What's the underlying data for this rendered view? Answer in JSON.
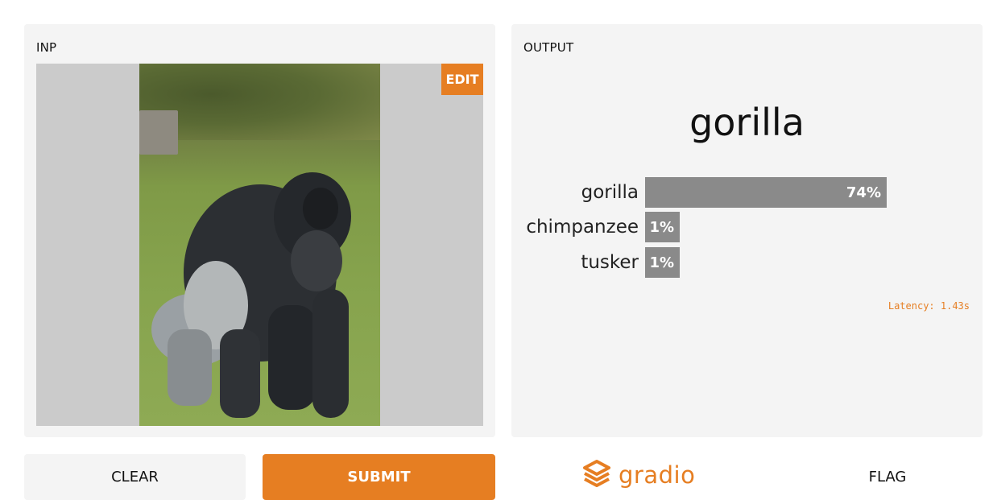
{
  "input_panel": {
    "title": "INP",
    "edit_label": "EDIT"
  },
  "output_panel": {
    "title": "OUTPUT",
    "label": "gorilla",
    "confidences": [
      {
        "name": "gorilla",
        "value": 0.74,
        "text": "74%"
      },
      {
        "name": "chimpanzee",
        "value": 0.01,
        "text": "1%"
      },
      {
        "name": "tusker",
        "value": 0.01,
        "text": "1%"
      }
    ],
    "latency": "Latency: 1.43s"
  },
  "buttons": {
    "clear": "CLEAR",
    "submit": "SUBMIT",
    "flag": "FLAG"
  },
  "brand": {
    "name": "gradio",
    "icon": "gradio-logo-icon"
  },
  "colors": {
    "accent": "#e67e22",
    "bar": "#8a8a8a",
    "panel": "#f4f4f4"
  }
}
